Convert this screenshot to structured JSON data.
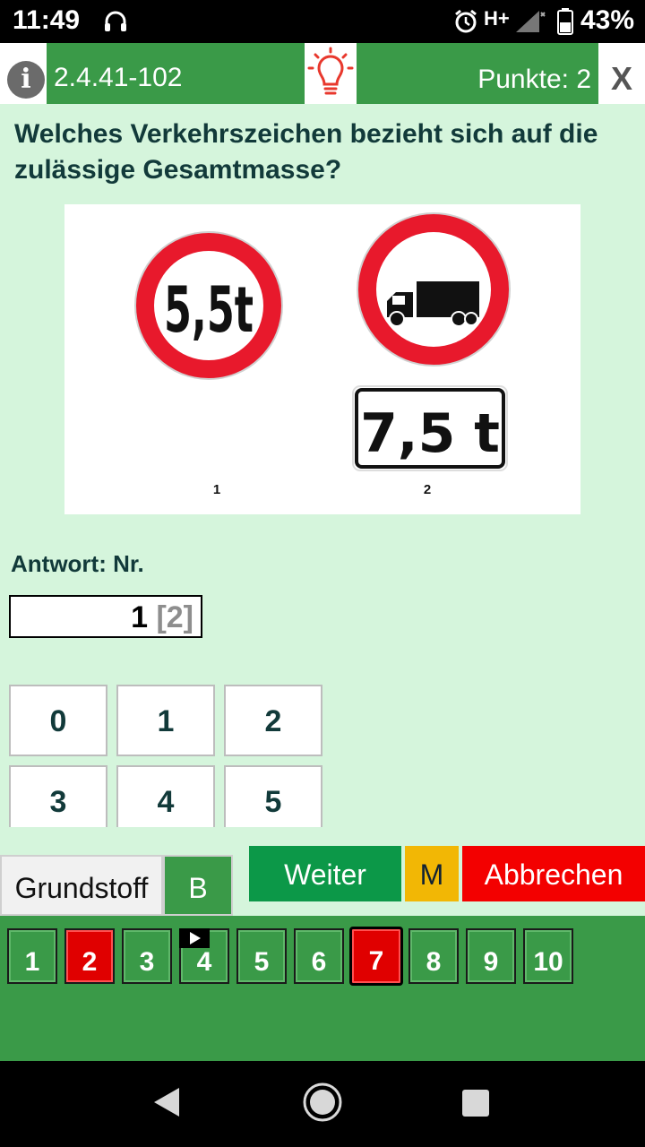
{
  "status_bar": {
    "time": "11:49",
    "network": "H+",
    "battery": "43%"
  },
  "header": {
    "info_label": "i",
    "question_id": "2.4.41-102",
    "score_label": "Punkte:",
    "score_value": "2",
    "close_label": "X",
    "accent_color": "#3a9a48"
  },
  "question": {
    "text": "Welches Verkehrszeichen bezieht sich auf die zulässige Gesamtmasse?"
  },
  "image": {
    "sign1_text": "5,5t",
    "sign1_number": "1",
    "sign2_plate": "7,5 t",
    "sign2_number": "2",
    "sign2_symbol": "truck-icon"
  },
  "answer": {
    "label": "Antwort: Nr.",
    "value": "1",
    "correct": "[2]"
  },
  "keypad": {
    "keys": [
      "0",
      "1",
      "2",
      "3",
      "4",
      "5"
    ]
  },
  "tabs": {
    "grundstoff": "Grundstoff",
    "b": "B"
  },
  "actions": {
    "weiter": "Weiter",
    "m": "M",
    "abbrechen": "Abbrechen"
  },
  "navigation": {
    "tiles": [
      {
        "label": "1",
        "state": "normal"
      },
      {
        "label": "2",
        "state": "wrong"
      },
      {
        "label": "3",
        "state": "normal"
      },
      {
        "label": "4",
        "state": "normal"
      },
      {
        "label": "5",
        "state": "normal"
      },
      {
        "label": "6",
        "state": "normal"
      },
      {
        "label": "7",
        "state": "wrong-current"
      },
      {
        "label": "8",
        "state": "normal"
      },
      {
        "label": "9",
        "state": "normal"
      },
      {
        "label": "10",
        "state": "normal"
      }
    ]
  }
}
